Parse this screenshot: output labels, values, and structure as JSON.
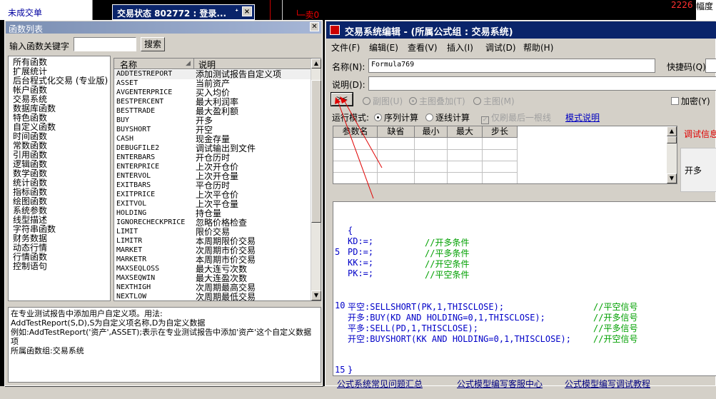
{
  "background": {
    "orders_label": "未成交单",
    "status_window_title": "交易状态 802772 : 登录...",
    "pin_glyph": "ᐩ",
    "close_glyph": "×",
    "order_marker": "└─卖0",
    "price_value": "2226",
    "range_label": "幅度"
  },
  "function_window": {
    "title": "函数列表",
    "keyword_label": "输入函数关键字",
    "keyword_value": "",
    "search_button": "搜索",
    "categories": [
      "所有函数",
      "扩展统计",
      "后台程式化交易 (专业版)",
      "帐户函数",
      "交易系统",
      "数据库函数",
      "特色函数",
      "自定义函数",
      "时间函数",
      "常数函数",
      "引用函数",
      "逻辑函数",
      "数学函数",
      "统计函数",
      "指标函数",
      "绘图函数",
      "系统参数",
      "线型描述",
      "字符串函数",
      "财务数据",
      "动态行情",
      "行情函数",
      "控制语句"
    ],
    "selected_category": "交易系统",
    "columns": [
      "名称",
      "说明"
    ],
    "functions": [
      {
        "name": "ADDTESTREPORT",
        "desc": "添加测试报告自定义项"
      },
      {
        "name": "ASSET",
        "desc": "当前资产"
      },
      {
        "name": "AVGENTERPRICE",
        "desc": "买入均价"
      },
      {
        "name": "BESTPERCENT",
        "desc": "最大利润率"
      },
      {
        "name": "BESTTRADE",
        "desc": "最大盈利额"
      },
      {
        "name": "BUY",
        "desc": "开多"
      },
      {
        "name": "BUYSHORT",
        "desc": "开空"
      },
      {
        "name": "CASH",
        "desc": "现金存量"
      },
      {
        "name": "DEBUGFILE2",
        "desc": "调试输出到文件"
      },
      {
        "name": "ENTERBARS",
        "desc": "开仓历时"
      },
      {
        "name": "ENTERPRICE",
        "desc": "上次开仓价"
      },
      {
        "name": "ENTERVOL",
        "desc": "上次开仓量"
      },
      {
        "name": "EXITBARS",
        "desc": "平仓历时"
      },
      {
        "name": "EXITPRICE",
        "desc": "上次平仓价"
      },
      {
        "name": "EXITVOL",
        "desc": "上次平仓量"
      },
      {
        "name": "HOLDING",
        "desc": "持仓量"
      },
      {
        "name": "IGNORECHECKPRICE",
        "desc": "忽略价格检查"
      },
      {
        "name": "LIMIT",
        "desc": "限价交易"
      },
      {
        "name": "LIMITR",
        "desc": "本周期限价交易"
      },
      {
        "name": "MARKET",
        "desc": "次周期市价交易"
      },
      {
        "name": "MARKETR",
        "desc": "本周期市价交易"
      },
      {
        "name": "MAXSEQLOSS",
        "desc": "最大连亏次数"
      },
      {
        "name": "MAXSEQWIN",
        "desc": "最大连盈次数"
      },
      {
        "name": "NEXTHIGH",
        "desc": "次周期最高交易"
      },
      {
        "name": "NEXTLOW",
        "desc": "次周期最低交易"
      }
    ],
    "description_lines": [
      "在专业测试报告中添加用户自定义项。用法:",
      "AddTestReport(S,D),S为自定义项名称,D为自定义数据",
      "例如:AddTestReport('资产',ASSET);表示在专业测试报告中添加'资产'这个自定义数据项",
      "所属函数组:交易系统"
    ]
  },
  "editor_window": {
    "title": "交易系统编辑 - (所属公式组 : 交易系统)",
    "menu": [
      "文件(F)",
      "编辑(E)",
      "查看(V)",
      "插入(I)",
      "调试(D)",
      "帮助(H)"
    ],
    "name_label": "名称(N):",
    "name_value": "Formula769",
    "hotkey_label": "快捷码(Q):",
    "desc_label": "说明(D):",
    "desc_value": "",
    "pin_button": "><",
    "chart_options": [
      "副图(U)",
      "主图叠加(T)",
      "主图(M)"
    ],
    "encrypt_label": "加密(Y)",
    "mode_label": "运行模式:",
    "mode_options": [
      "序列计算",
      "逐线计算"
    ],
    "last_bar_label": "仅刷最后一根线",
    "mode_link": "模式说明",
    "param_columns": [
      "参数名",
      "缺省",
      "最小",
      "最大",
      "步长"
    ],
    "debug_info_label": "调试信息",
    "debug_value": "开多",
    "code_lines": [
      {
        "num": "",
        "code": "{",
        "comment": ""
      },
      {
        "num": "",
        "code": "KD:=;",
        "comment": "//开多条件"
      },
      {
        "num": "5",
        "code": "PD:=;",
        "comment": "//平多条件"
      },
      {
        "num": "",
        "code": "KK:=;",
        "comment": "//开空条件"
      },
      {
        "num": "",
        "code": "PK:=;",
        "comment": "//平空条件"
      },
      {
        "num": "",
        "code": "",
        "comment": ""
      },
      {
        "num": "",
        "code": "",
        "comment": ""
      },
      {
        "num": "10",
        "code": "平空:SELLSHORT(PK,1,THISCLOSE);",
        "comment": "//平空信号"
      },
      {
        "num": "",
        "code": "开多:BUY(KD AND HOLDING=0,1,THISCLOSE);",
        "comment": "//开多信号"
      },
      {
        "num": "",
        "code": "平多:SELL(PD,1,THISCLOSE);",
        "comment": "//平多信号"
      },
      {
        "num": "",
        "code": "开空:BUYSHORT(KK AND HOLDING=0,1,THISCLOSE);",
        "comment": "//开空信号"
      },
      {
        "num": "",
        "code": "",
        "comment": ""
      },
      {
        "num": "",
        "code": "",
        "comment": ""
      },
      {
        "num": "15",
        "code": "}",
        "comment": ""
      }
    ],
    "footer_links": [
      "公式系统常见问题汇总",
      "公式模型编写客服中心",
      "公式模型编写调试教程"
    ]
  },
  "colors": {
    "title_active": "#0a246a",
    "title_inactive": "#7b8fb3",
    "code_text": "#0000c8",
    "code_comment": "#00a000",
    "annotation": "#e00000"
  }
}
